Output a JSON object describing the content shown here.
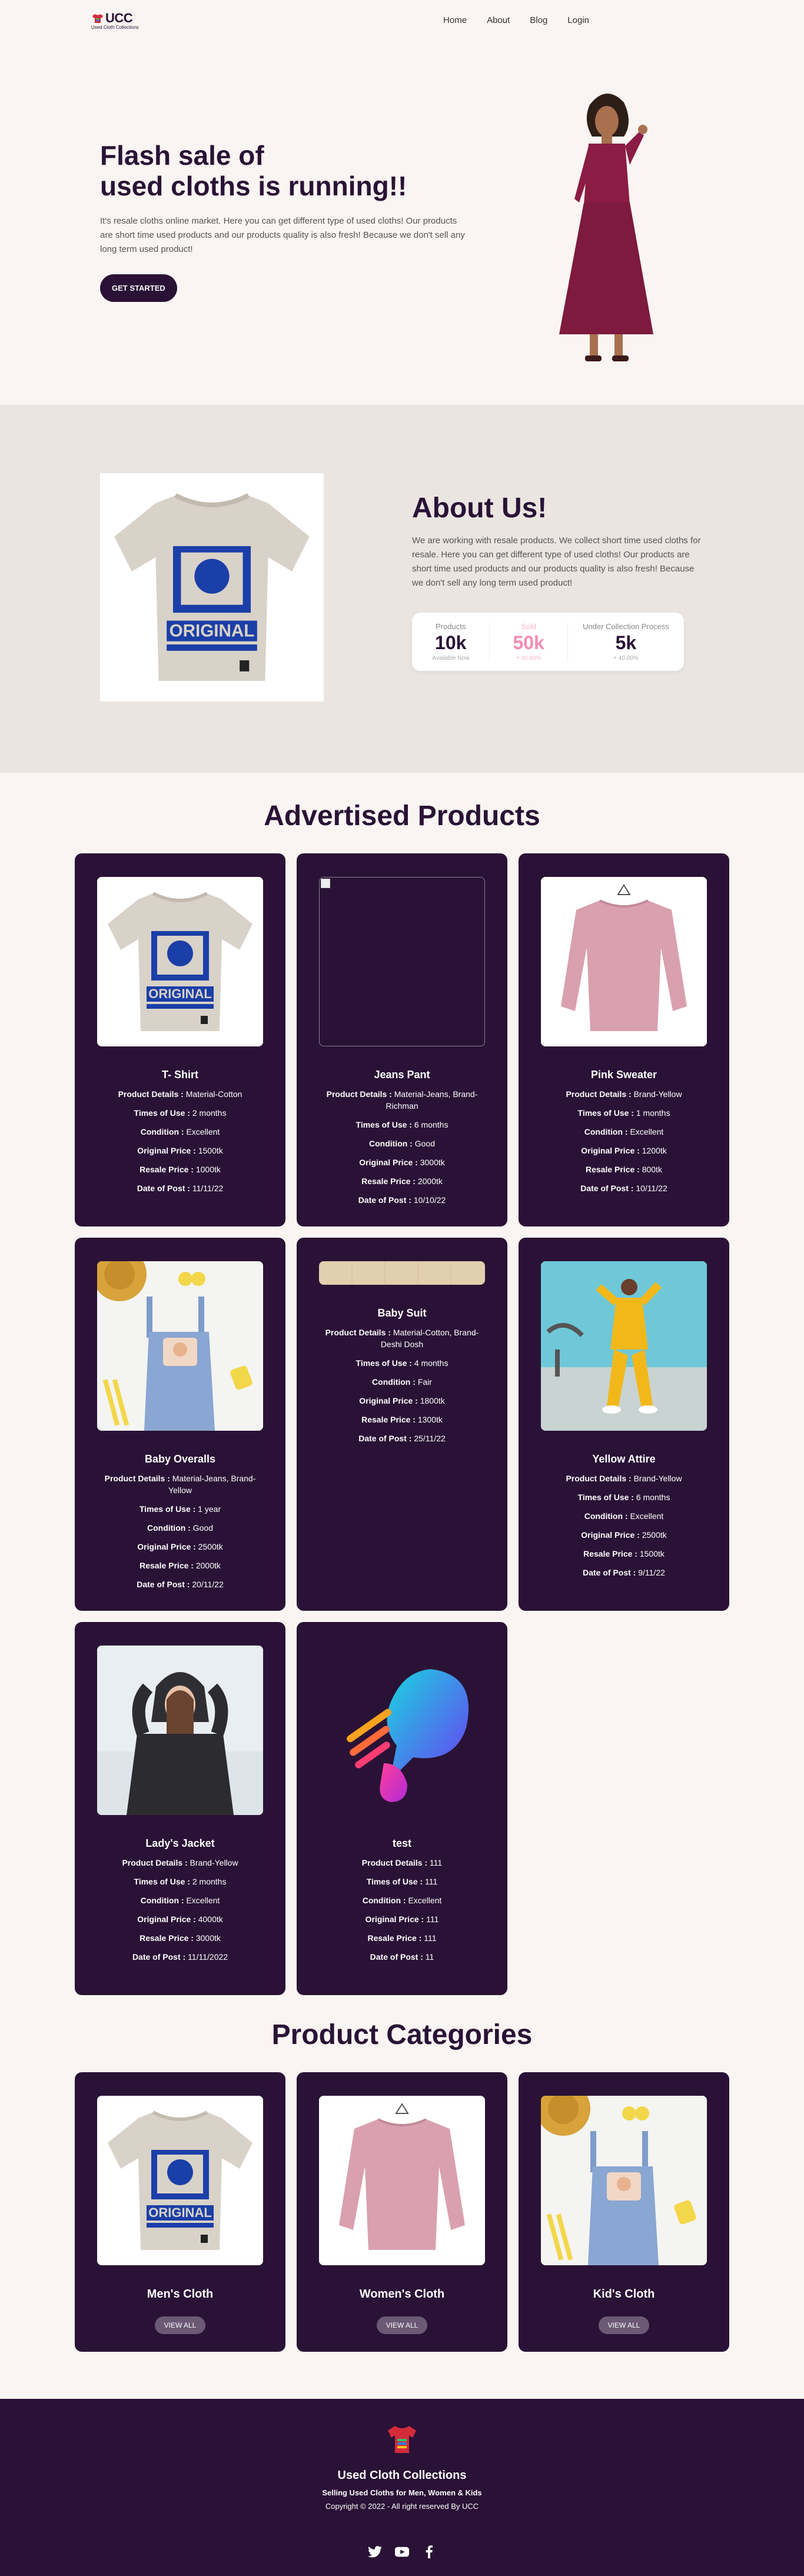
{
  "nav": {
    "brand": "UCC",
    "brand_sub": "Used Cloth Collections",
    "links": [
      "Home",
      "About",
      "Blog",
      "Login"
    ]
  },
  "hero": {
    "title_line1": "Flash sale of",
    "title_line2": "used cloths is running!!",
    "description": "It's resale cloths online market. Here you can get different type of used cloths! Our products are short time used products and our products quality is also fresh! Because we don't sell any long term used product!",
    "cta": "GET STARTED"
  },
  "about": {
    "title": "About Us!",
    "description": "We are working with resale products. We collect short time used cloths for resale. Here you can get different type of used cloths! Our products are short time used products and our products quality is also fresh! Because we don't sell any long term used product!",
    "stats": [
      {
        "label": "Products",
        "value": "10k",
        "sub": "Available Now"
      },
      {
        "label": "Sold",
        "value": "50k",
        "sub": "+ 40.00%"
      },
      {
        "label": "Under Collection Process",
        "value": "5k",
        "sub": "+ 40.00%"
      }
    ]
  },
  "advertised": {
    "title": "Advertised Products",
    "field_labels": {
      "details": "Product Details :",
      "use": "Times of Use :",
      "condition": "Condition :",
      "original": "Original Price :",
      "resale": "Resale Price :",
      "date": "Date of Post :"
    },
    "products": [
      {
        "name": "T- Shirt",
        "details": "Material-Cotton",
        "use": "2 months",
        "condition": "Excellent",
        "original": "1500tk",
        "resale": "1000tk",
        "date": "11/11/22",
        "image": "tshirt"
      },
      {
        "name": "Jeans Pant",
        "details": "Material-Jeans, Brand-Richman",
        "use": "6 months",
        "condition": "Good",
        "original": "3000tk",
        "resale": "2000tk",
        "date": "10/10/22",
        "image": "broken"
      },
      {
        "name": "Pink Sweater",
        "details": "Brand-Yellow",
        "use": "1 months",
        "condition": "Excellent",
        "original": "1200tk",
        "resale": "800tk",
        "date": "10/11/22",
        "image": "sweater"
      },
      {
        "name": "Baby Overalls",
        "details": "Material-Jeans, Brand-Yellow",
        "use": "1 year",
        "condition": "Good",
        "original": "2500tk",
        "resale": "2000tk",
        "date": "20/11/22",
        "image": "overalls"
      },
      {
        "name": "Baby Suit",
        "details": "Material-Cotton, Brand-Deshi Dosh",
        "use": "4 months",
        "condition": "Fair",
        "original": "1800tk",
        "resale": "1300tk",
        "date": "25/11/22",
        "image": "crop"
      },
      {
        "name": "Yellow Attire",
        "details": "Brand-Yellow",
        "use": "6 months",
        "condition": "Excellent",
        "original": "2500tk",
        "resale": "1500tk",
        "date": "9/11/22",
        "image": "yellow"
      },
      {
        "name": "Lady's Jacket",
        "details": "Brand-Yellow",
        "use": "2 months",
        "condition": "Excellent",
        "original": "4000tk",
        "resale": "3000tk",
        "date": "11/11/2022",
        "image": "jacket"
      },
      {
        "name": "test",
        "details": "111",
        "use": "111",
        "condition": "Excellent",
        "original": "111",
        "resale": "111",
        "date": "11",
        "image": "logo"
      }
    ]
  },
  "categories": {
    "title": "Product Categories",
    "button": "VIEW ALL",
    "items": [
      {
        "name": "Men's Cloth",
        "image": "tshirt"
      },
      {
        "name": "Women's Cloth",
        "image": "sweater"
      },
      {
        "name": "Kid's Cloth",
        "image": "overalls"
      }
    ]
  },
  "footer": {
    "title": "Used Cloth Collections",
    "tagline": "Selling Used Cloths for Men, Women & Kids",
    "copyright": "Copyright © 2022 - All right reserved By UCC",
    "socials": [
      "twitter-icon",
      "youtube-icon",
      "facebook-icon"
    ]
  },
  "colors": {
    "primary": "#2a1236",
    "background": "#faf5f2",
    "about_bg": "#ebe5e1",
    "accent_pink": "#f28db2"
  }
}
